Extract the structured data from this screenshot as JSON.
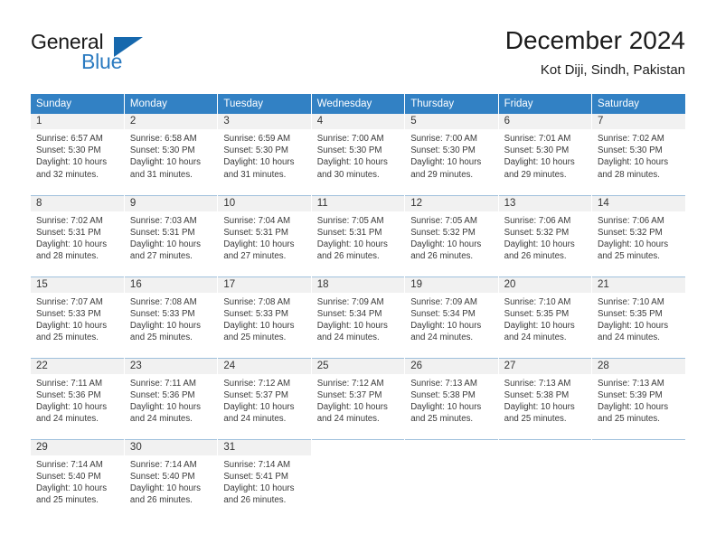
{
  "logo": {
    "word_top": "General",
    "word_bottom": "Blue",
    "triangle_color": "#1668ad",
    "blue_text_color": "#2a7ac0"
  },
  "header": {
    "title": "December 2024",
    "subtitle": "Kot Diji, Sindh, Pakistan"
  },
  "theme": {
    "header_row_bg": "#3281c4",
    "daynum_bg": "#f1f1f1",
    "week_divider": "#9fc0dc"
  },
  "weekdays": [
    "Sunday",
    "Monday",
    "Tuesday",
    "Wednesday",
    "Thursday",
    "Friday",
    "Saturday"
  ],
  "weeks": [
    [
      {
        "day": "1",
        "sunrise": "Sunrise: 6:57 AM",
        "sunset": "Sunset: 5:30 PM",
        "daylight1": "Daylight: 10 hours",
        "daylight2": "and 32 minutes."
      },
      {
        "day": "2",
        "sunrise": "Sunrise: 6:58 AM",
        "sunset": "Sunset: 5:30 PM",
        "daylight1": "Daylight: 10 hours",
        "daylight2": "and 31 minutes."
      },
      {
        "day": "3",
        "sunrise": "Sunrise: 6:59 AM",
        "sunset": "Sunset: 5:30 PM",
        "daylight1": "Daylight: 10 hours",
        "daylight2": "and 31 minutes."
      },
      {
        "day": "4",
        "sunrise": "Sunrise: 7:00 AM",
        "sunset": "Sunset: 5:30 PM",
        "daylight1": "Daylight: 10 hours",
        "daylight2": "and 30 minutes."
      },
      {
        "day": "5",
        "sunrise": "Sunrise: 7:00 AM",
        "sunset": "Sunset: 5:30 PM",
        "daylight1": "Daylight: 10 hours",
        "daylight2": "and 29 minutes."
      },
      {
        "day": "6",
        "sunrise": "Sunrise: 7:01 AM",
        "sunset": "Sunset: 5:30 PM",
        "daylight1": "Daylight: 10 hours",
        "daylight2": "and 29 minutes."
      },
      {
        "day": "7",
        "sunrise": "Sunrise: 7:02 AM",
        "sunset": "Sunset: 5:30 PM",
        "daylight1": "Daylight: 10 hours",
        "daylight2": "and 28 minutes."
      }
    ],
    [
      {
        "day": "8",
        "sunrise": "Sunrise: 7:02 AM",
        "sunset": "Sunset: 5:31 PM",
        "daylight1": "Daylight: 10 hours",
        "daylight2": "and 28 minutes."
      },
      {
        "day": "9",
        "sunrise": "Sunrise: 7:03 AM",
        "sunset": "Sunset: 5:31 PM",
        "daylight1": "Daylight: 10 hours",
        "daylight2": "and 27 minutes."
      },
      {
        "day": "10",
        "sunrise": "Sunrise: 7:04 AM",
        "sunset": "Sunset: 5:31 PM",
        "daylight1": "Daylight: 10 hours",
        "daylight2": "and 27 minutes."
      },
      {
        "day": "11",
        "sunrise": "Sunrise: 7:05 AM",
        "sunset": "Sunset: 5:31 PM",
        "daylight1": "Daylight: 10 hours",
        "daylight2": "and 26 minutes."
      },
      {
        "day": "12",
        "sunrise": "Sunrise: 7:05 AM",
        "sunset": "Sunset: 5:32 PM",
        "daylight1": "Daylight: 10 hours",
        "daylight2": "and 26 minutes."
      },
      {
        "day": "13",
        "sunrise": "Sunrise: 7:06 AM",
        "sunset": "Sunset: 5:32 PM",
        "daylight1": "Daylight: 10 hours",
        "daylight2": "and 26 minutes."
      },
      {
        "day": "14",
        "sunrise": "Sunrise: 7:06 AM",
        "sunset": "Sunset: 5:32 PM",
        "daylight1": "Daylight: 10 hours",
        "daylight2": "and 25 minutes."
      }
    ],
    [
      {
        "day": "15",
        "sunrise": "Sunrise: 7:07 AM",
        "sunset": "Sunset: 5:33 PM",
        "daylight1": "Daylight: 10 hours",
        "daylight2": "and 25 minutes."
      },
      {
        "day": "16",
        "sunrise": "Sunrise: 7:08 AM",
        "sunset": "Sunset: 5:33 PM",
        "daylight1": "Daylight: 10 hours",
        "daylight2": "and 25 minutes."
      },
      {
        "day": "17",
        "sunrise": "Sunrise: 7:08 AM",
        "sunset": "Sunset: 5:33 PM",
        "daylight1": "Daylight: 10 hours",
        "daylight2": "and 25 minutes."
      },
      {
        "day": "18",
        "sunrise": "Sunrise: 7:09 AM",
        "sunset": "Sunset: 5:34 PM",
        "daylight1": "Daylight: 10 hours",
        "daylight2": "and 24 minutes."
      },
      {
        "day": "19",
        "sunrise": "Sunrise: 7:09 AM",
        "sunset": "Sunset: 5:34 PM",
        "daylight1": "Daylight: 10 hours",
        "daylight2": "and 24 minutes."
      },
      {
        "day": "20",
        "sunrise": "Sunrise: 7:10 AM",
        "sunset": "Sunset: 5:35 PM",
        "daylight1": "Daylight: 10 hours",
        "daylight2": "and 24 minutes."
      },
      {
        "day": "21",
        "sunrise": "Sunrise: 7:10 AM",
        "sunset": "Sunset: 5:35 PM",
        "daylight1": "Daylight: 10 hours",
        "daylight2": "and 24 minutes."
      }
    ],
    [
      {
        "day": "22",
        "sunrise": "Sunrise: 7:11 AM",
        "sunset": "Sunset: 5:36 PM",
        "daylight1": "Daylight: 10 hours",
        "daylight2": "and 24 minutes."
      },
      {
        "day": "23",
        "sunrise": "Sunrise: 7:11 AM",
        "sunset": "Sunset: 5:36 PM",
        "daylight1": "Daylight: 10 hours",
        "daylight2": "and 24 minutes."
      },
      {
        "day": "24",
        "sunrise": "Sunrise: 7:12 AM",
        "sunset": "Sunset: 5:37 PM",
        "daylight1": "Daylight: 10 hours",
        "daylight2": "and 24 minutes."
      },
      {
        "day": "25",
        "sunrise": "Sunrise: 7:12 AM",
        "sunset": "Sunset: 5:37 PM",
        "daylight1": "Daylight: 10 hours",
        "daylight2": "and 24 minutes."
      },
      {
        "day": "26",
        "sunrise": "Sunrise: 7:13 AM",
        "sunset": "Sunset: 5:38 PM",
        "daylight1": "Daylight: 10 hours",
        "daylight2": "and 25 minutes."
      },
      {
        "day": "27",
        "sunrise": "Sunrise: 7:13 AM",
        "sunset": "Sunset: 5:38 PM",
        "daylight1": "Daylight: 10 hours",
        "daylight2": "and 25 minutes."
      },
      {
        "day": "28",
        "sunrise": "Sunrise: 7:13 AM",
        "sunset": "Sunset: 5:39 PM",
        "daylight1": "Daylight: 10 hours",
        "daylight2": "and 25 minutes."
      }
    ],
    [
      {
        "day": "29",
        "sunrise": "Sunrise: 7:14 AM",
        "sunset": "Sunset: 5:40 PM",
        "daylight1": "Daylight: 10 hours",
        "daylight2": "and 25 minutes."
      },
      {
        "day": "30",
        "sunrise": "Sunrise: 7:14 AM",
        "sunset": "Sunset: 5:40 PM",
        "daylight1": "Daylight: 10 hours",
        "daylight2": "and 26 minutes."
      },
      {
        "day": "31",
        "sunrise": "Sunrise: 7:14 AM",
        "sunset": "Sunset: 5:41 PM",
        "daylight1": "Daylight: 10 hours",
        "daylight2": "and 26 minutes."
      },
      {
        "day": "",
        "sunrise": "",
        "sunset": "",
        "daylight1": "",
        "daylight2": ""
      },
      {
        "day": "",
        "sunrise": "",
        "sunset": "",
        "daylight1": "",
        "daylight2": ""
      },
      {
        "day": "",
        "sunrise": "",
        "sunset": "",
        "daylight1": "",
        "daylight2": ""
      },
      {
        "day": "",
        "sunrise": "",
        "sunset": "",
        "daylight1": "",
        "daylight2": ""
      }
    ]
  ]
}
